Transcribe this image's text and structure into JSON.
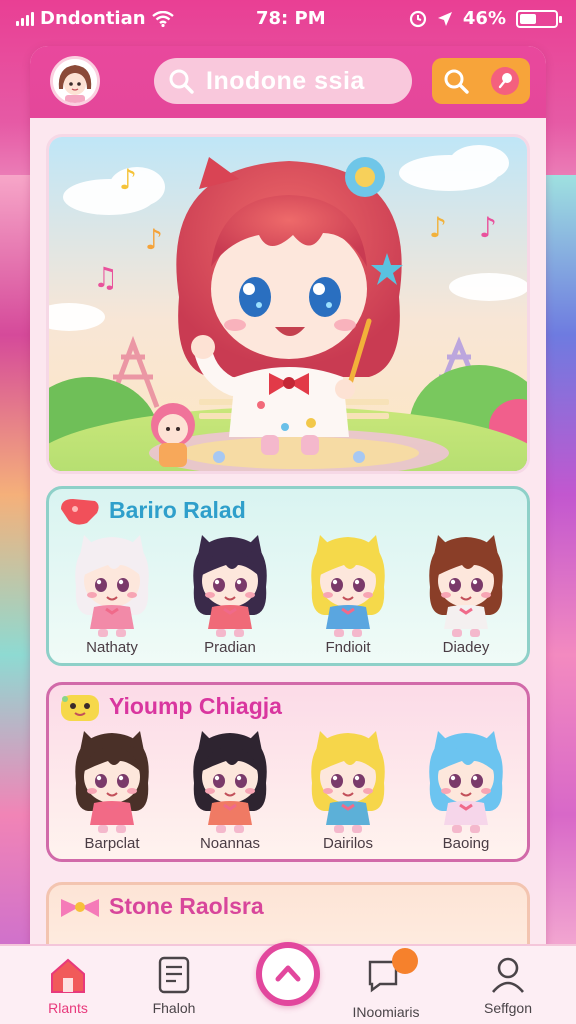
{
  "status_bar": {
    "carrier": "Dndontian",
    "time": "78: PM",
    "battery": "46%",
    "battery_level": 0.46
  },
  "header": {
    "search_label": "Inodone ssia",
    "avatar": "profile-avatar",
    "actions": [
      "search-icon",
      "pin-icon"
    ]
  },
  "hero": {
    "image": "chibi-idol-girl-waving-in-park"
  },
  "sections": [
    {
      "title": "Bariro Ralad",
      "badge": "candy-icon",
      "characters": [
        {
          "name": "Nathaty",
          "hair": "#f4eef2",
          "outfit": "#f28aa8"
        },
        {
          "name": "Pradian",
          "hair": "#3a2a4a",
          "outfit": "#f06a78"
        },
        {
          "name": "Fndioit",
          "hair": "#f5d94a",
          "outfit": "#5aa6e0"
        },
        {
          "name": "Diadey",
          "hair": "#8a3e28",
          "outfit": "#f4f0f0"
        }
      ]
    },
    {
      "title": "Yioump Chiagja",
      "badge": "sponge-icon",
      "characters": [
        {
          "name": "Barpclat",
          "hair": "#4a3028",
          "outfit": "#f26a86"
        },
        {
          "name": "Noannas",
          "hair": "#2e2430",
          "outfit": "#f07a64"
        },
        {
          "name": "Dairilos",
          "hair": "#f6d64a",
          "outfit": "#5cb0d8"
        },
        {
          "name": "Baoing",
          "hair": "#6cc4f0",
          "outfit": "#f6d6ea"
        }
      ]
    },
    {
      "title": "Stone Raolsra",
      "badge": "bow-icon",
      "characters": []
    }
  ],
  "nav": [
    {
      "label": "Rlants",
      "icon": "home-icon",
      "active": true
    },
    {
      "label": "Fhaloh",
      "icon": "document-icon",
      "active": false
    },
    {
      "label": "",
      "icon": "chevron-up-icon",
      "active": false
    },
    {
      "label": "INoomiaris",
      "icon": "message-icon",
      "active": false
    },
    {
      "label": "Seffgon",
      "icon": "profile-icon",
      "active": false
    }
  ],
  "colors": {
    "brand_pink": "#e4479a",
    "accent_orange": "#f7a43a",
    "nav_active": "#e8397c"
  }
}
